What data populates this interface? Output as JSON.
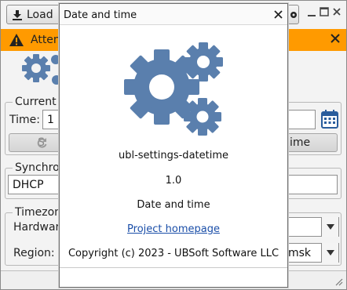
{
  "toolbar": {
    "load_label": "Load"
  },
  "warning": {
    "text": "Attent"
  },
  "current_group": {
    "legend": "Current d",
    "time_label": "Time:",
    "time_value": "1",
    "date_value": "",
    "sync_button_label": "S",
    "apply_button_label": "ime"
  },
  "sync_group": {
    "legend": "Synchron",
    "value": "DHCP"
  },
  "timezone_group": {
    "legend": "Timezone",
    "hardware_label": "Hardware",
    "region_label": "Region:",
    "region_value": "msk"
  },
  "dialog": {
    "title": "Date and time",
    "app_name": "ubl-settings-datetime",
    "version": "1.0",
    "description": "Date and time",
    "homepage_link": "Project homepage",
    "copyright": "Copyright (c) 2023 - UBSoft Software LLC"
  },
  "colors": {
    "gear_blue": "#5a7fad",
    "warning_orange": "#ff9a00",
    "link_blue": "#1a4ea8",
    "calendar_blue": "#2a5d9c"
  }
}
